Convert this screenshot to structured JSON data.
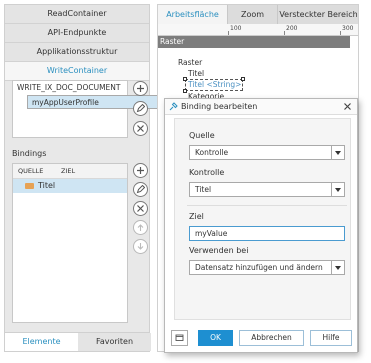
{
  "left_panel": {
    "sections": [
      {
        "label": "ReadContainer"
      },
      {
        "label": "API-Endpunkte"
      },
      {
        "label": "Applikationsstruktur"
      },
      {
        "label": "WriteContainer"
      }
    ],
    "containers": [
      "WRITE_IX_DOC_DOCUMENT",
      "myAppUserProfile"
    ],
    "bindings_label": "Bindings",
    "columns": {
      "source": "QUELLE",
      "target": "ZIEL"
    },
    "binding_rows": [
      {
        "source": "Titel",
        "target": ""
      }
    ],
    "bottom_tabs": [
      "Elemente",
      "Favoriten"
    ]
  },
  "workspace": {
    "tabs": [
      "Arbeitsfläche",
      "Zoom",
      "Versteckter Bereich"
    ],
    "ruler_marks": [
      "100",
      "200",
      "300"
    ],
    "raster_header": "Raster",
    "canvas_labels": {
      "raster": "Raster",
      "titel": "Titel",
      "titel_binding": "Titel <String>",
      "kategorie": "Kategorie"
    }
  },
  "dialog": {
    "title": "Binding bearbeiten",
    "fields": {
      "quelle": {
        "label": "Quelle",
        "value": "Kontrolle"
      },
      "kontrolle": {
        "label": "Kontrolle",
        "value": "Titel"
      },
      "ziel": {
        "label": "Ziel",
        "value": "myValue"
      },
      "verwenden": {
        "label": "Verwenden bei",
        "value": "Datensatz hinzufügen und ändern"
      }
    },
    "buttons": {
      "ok": "OK",
      "cancel": "Abbrechen",
      "help": "Hilfe"
    }
  },
  "colors": {
    "accent": "#2a8fbf",
    "selection": "#cfe5f3",
    "ok_button": "#1e8fd1"
  }
}
